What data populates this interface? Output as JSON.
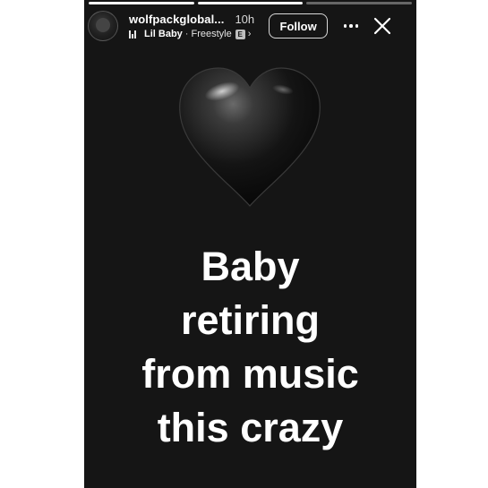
{
  "progress": {
    "segments": [
      1,
      1,
      0.0
    ]
  },
  "header": {
    "username": "wolfpackglobal...",
    "time": "10h",
    "music": {
      "icon": "equalizer-icon",
      "artist": "Lil Baby",
      "separator": "·",
      "track": "Freestyle",
      "explicit_label": "E",
      "chevron": "›"
    },
    "follow_label": "Follow",
    "more_icon": "more-horizontal-icon",
    "close_icon": "close-icon"
  },
  "content": {
    "heart_icon": "black-heart-icon",
    "caption_lines": [
      "Baby",
      "retiring",
      "from music",
      "this crazy"
    ]
  },
  "colors": {
    "story_bg": "#151515",
    "page_bg": "#ffffff",
    "text": "#ffffff"
  }
}
